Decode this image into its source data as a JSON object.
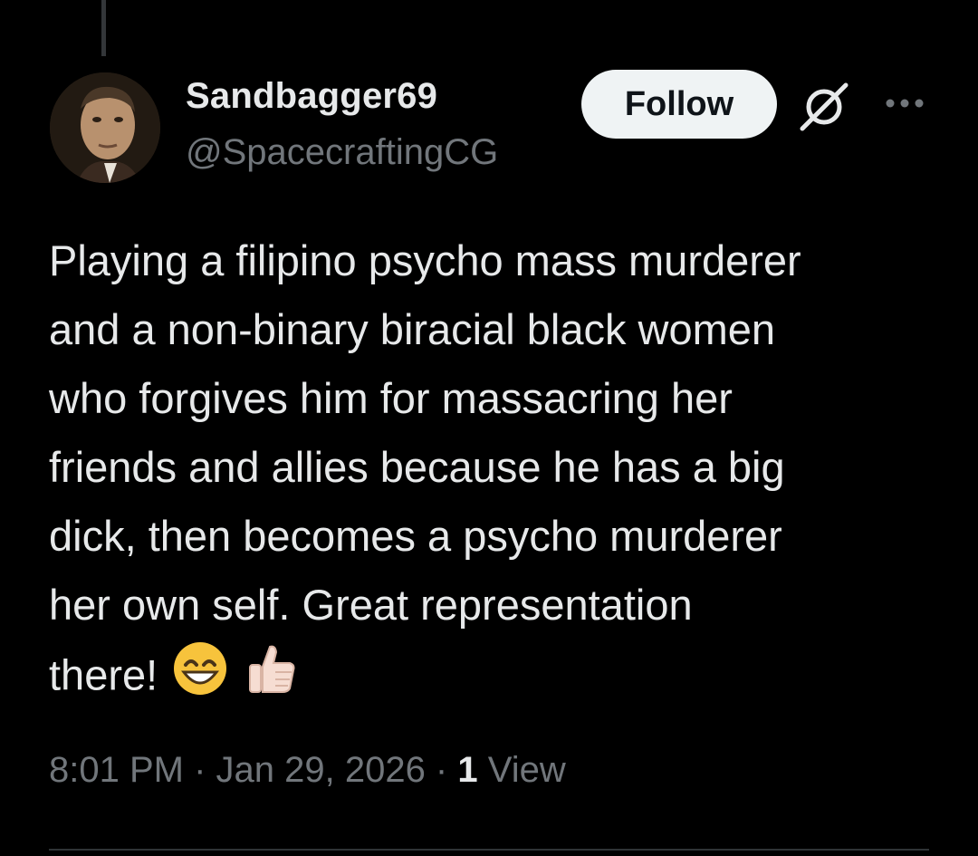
{
  "tweet": {
    "author": {
      "display_name": "Sandbagger69",
      "handle": "@SpacecraftingCG",
      "avatar_icon": "avatar-photo"
    },
    "follow_label": "Follow",
    "grok_icon": "grok-icon",
    "more_icon": "more-options-icon",
    "text_lines": [
      "Playing a filipino psycho mass murderer",
      "and a non-binary biracial black women",
      "who forgives him for massacring her",
      "friends and allies because he has a big",
      "dick, then becomes a psycho murderer",
      "her own self.  Great representation",
      "there!"
    ],
    "emojis": [
      "😄",
      "👍🏻"
    ],
    "timestamp": "8:01 PM · Jan 29, 2026 · ",
    "view_count": "1",
    "view_label": " View"
  },
  "colors": {
    "background": "#000000",
    "text_primary": "#e7e9ea",
    "text_secondary": "#71767b",
    "follow_bg": "#eff3f4",
    "divider": "#2f3336"
  }
}
